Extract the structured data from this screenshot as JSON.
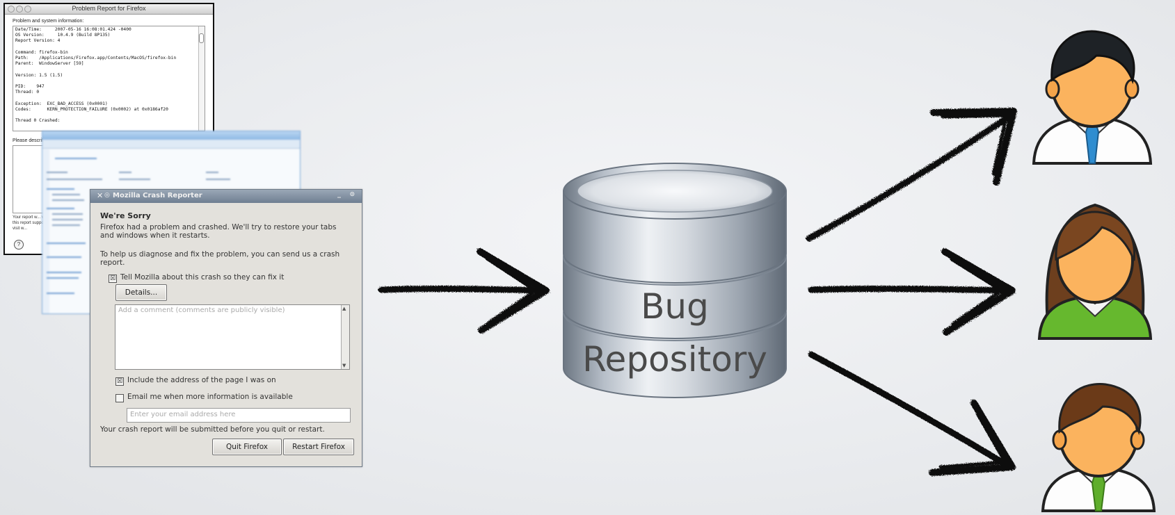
{
  "mac_report": {
    "title": "Problem Report for Firefox",
    "section_label": "Problem and system information:",
    "log_text": "Date/Time:     2007-05-16 16:08:01.424 -0400\nOS Version:     10.4.9 (Build 8P135)\nReport Version: 4\n\nCommand: firefox-bin\nPath:    /Applications/Firefox.app/Contents/MacOS/firefox-bin\nParent:  WindowServer [59]\n\nVersion: 1.5 (1.5)\n\nPID:    947\nThread: 0\n\nException:  EXC_BAD_ACCESS (0x0001)\nCodes:      KERN_PROTECTION_FAILURE (0x0002) at 0x0186af20\n\nThread 0 Crashed:",
    "describe_label": "Please describe what you were doing when the problem happened:",
    "note_text": "Your report w... with this report support, visit w...",
    "help_glyph": "?"
  },
  "crash_reporter": {
    "title": "Mozilla Crash Reporter",
    "close_glyph": "✕",
    "menu_glyph": "◎",
    "min_glyph": "_",
    "max_glyph": "⊙",
    "heading": "We're Sorry",
    "para1": "Firefox had a problem and crashed. We'll try to restore your tabs and windows when it restarts.",
    "para2": "To help us diagnose and fix the problem, you can send us a crash report.",
    "tell_mozilla_label": "Tell Mozilla about this crash so they can fix it",
    "tell_mozilla_checked": "☒",
    "details_button": "Details...",
    "comment_placeholder": "Add a comment (comments are publicly visible)",
    "include_address_label": "Include the address of the page I was on",
    "include_address_checked": "☒",
    "email_me_label": "Email me when more information is available",
    "email_placeholder": "Enter your email address here",
    "submit_note": "Your crash report will be submitted before you quit or restart.",
    "quit_button": "Quit Firefox",
    "restart_button": "Restart Firefox"
  },
  "repository": {
    "line1": "Bug",
    "line2": "Repository"
  },
  "icons": {
    "input_arrow": "hand-drawn-arrow-icon",
    "database": "database-icon",
    "developer_1": "male-developer-blue-tie-icon",
    "developer_2": "female-developer-icon",
    "developer_3": "male-developer-green-tie-icon"
  },
  "colors": {
    "background": "#eceef0",
    "db_body": "#9aa3ad",
    "arrow": "#111111",
    "skin": "#fbb35e",
    "tie_blue": "#2f8dd0",
    "shirt_green": "#66b82e"
  }
}
